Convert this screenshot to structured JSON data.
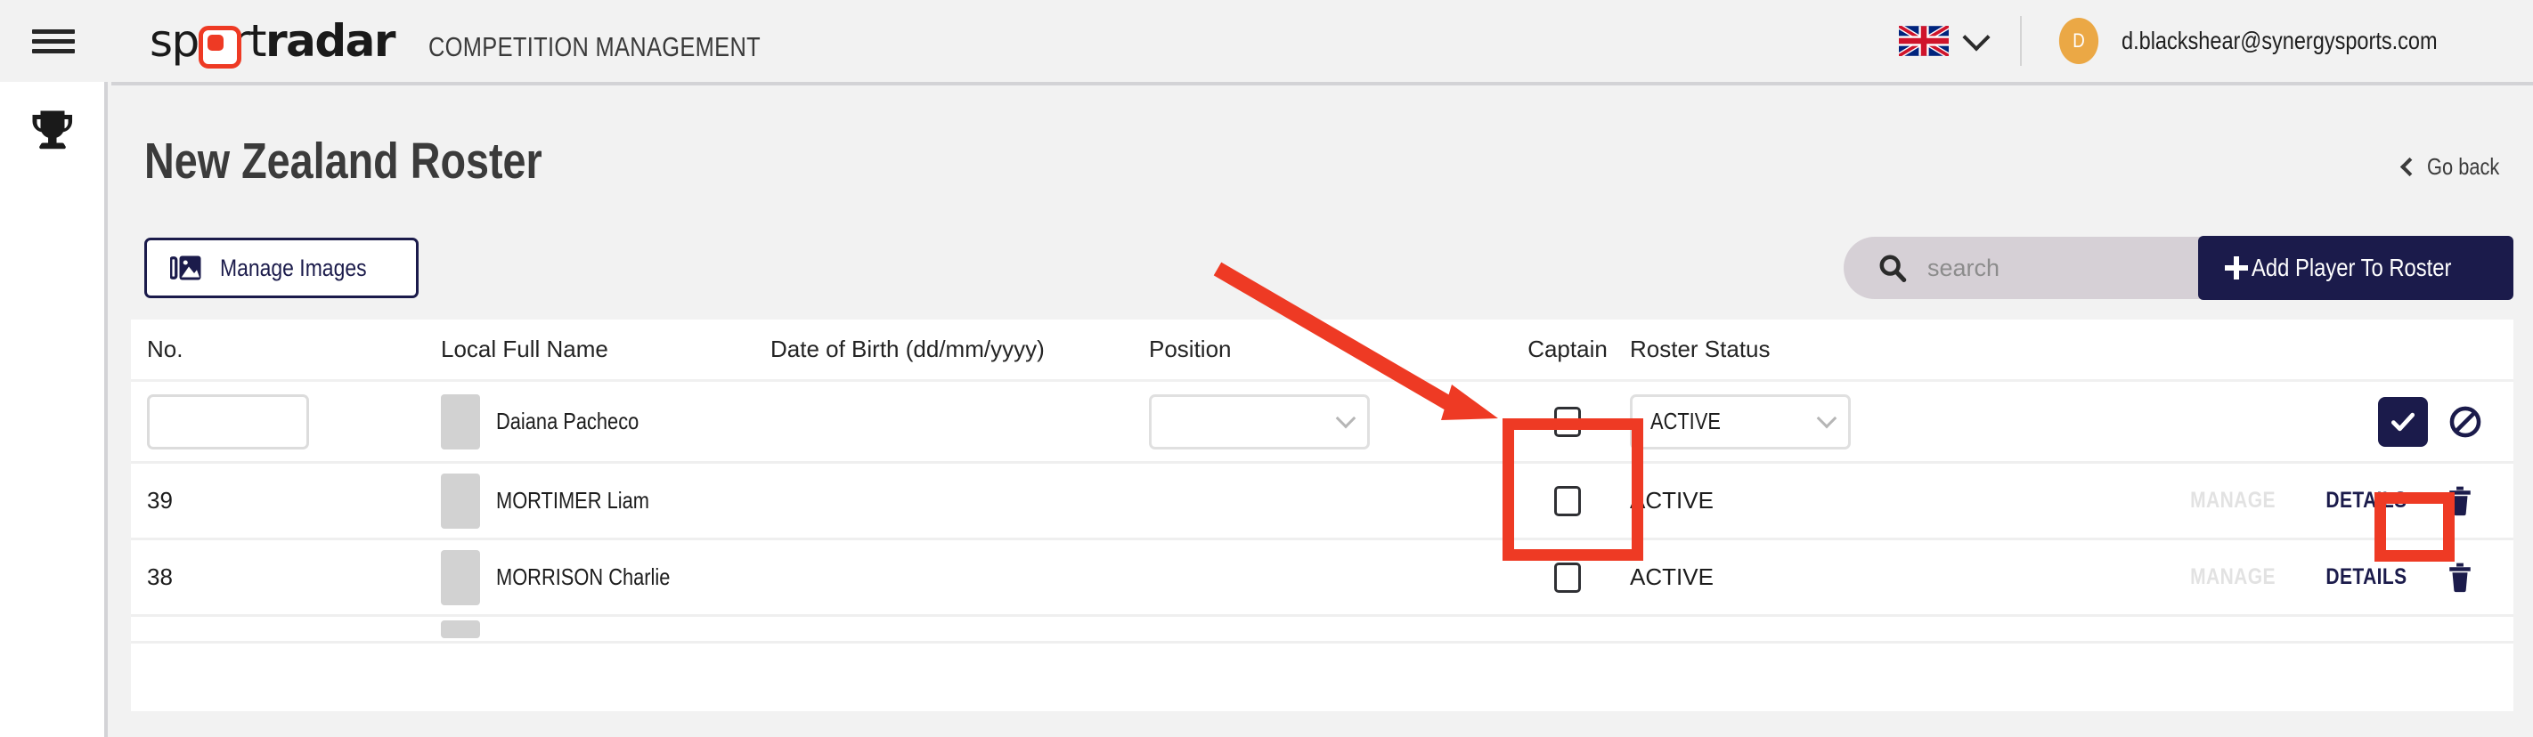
{
  "topbar": {
    "menu_icon": "hamburger-icon",
    "logo_part1": "sp",
    "logo_part2": "rt",
    "logo_part3": "radar",
    "app_title": "COMPETITION MANAGEMENT",
    "language_icon": "uk-flag-icon",
    "language_chevron": "chevron-down-icon",
    "avatar_initial": "D",
    "user_email": "d.blackshear@synergysports.com",
    "avatar_color": "#eba845"
  },
  "sidebar": {
    "items": [
      {
        "icon": "trophy-icon",
        "label": "Competitions"
      }
    ]
  },
  "page": {
    "title": "New Zealand Roster",
    "go_back_label": "Go back",
    "go_back_icon": "chevron-left-icon"
  },
  "toolbar": {
    "manage_images_label": "Manage Images",
    "manage_images_icon": "images-icon",
    "search_icon": "search-icon",
    "search_value": "",
    "search_placeholder": "search",
    "add_player_label": "Add Player To Roster",
    "add_player_icon": "plus-icon"
  },
  "table": {
    "headers": [
      "No.",
      "Local Full Name",
      "Date of Birth (dd/mm/yyyy)",
      "Position",
      "Captain",
      "Roster Status",
      ""
    ],
    "edit_row": {
      "no_value": "",
      "no_placeholder": "",
      "name": "Daiana Pacheco",
      "dob": "",
      "position_value": "",
      "captain_checked": false,
      "status_value": "ACTIVE",
      "confirm_icon": "check-icon",
      "cancel_icon": "ban-icon"
    },
    "rows": [
      {
        "no": "39",
        "name": "MORTIMER Liam",
        "dob": "",
        "position": "",
        "captain_checked": false,
        "status": "ACTIVE",
        "manage_label": "MANAGE",
        "details_label": "DETAILS",
        "delete_icon": "trash-icon"
      },
      {
        "no": "38",
        "name": "MORRISON Charlie",
        "dob": "",
        "position": "",
        "captain_checked": false,
        "status": "ACTIVE",
        "manage_label": "MANAGE",
        "details_label": "DETAILS",
        "delete_icon": "trash-icon"
      }
    ]
  },
  "annotations": {
    "arrow_color": "#ee3a24",
    "box_color": "#ee3a24",
    "arrow_name": "red-arrow-pointing-to-captain-column",
    "box1_name": "captain-column-highlight",
    "box2_name": "confirm-button-highlight"
  },
  "colors": {
    "brand_red": "#ee3a24",
    "navy": "#1b1b4b",
    "page_bg": "#f2f2f2",
    "card_bg": "#ffffff"
  }
}
